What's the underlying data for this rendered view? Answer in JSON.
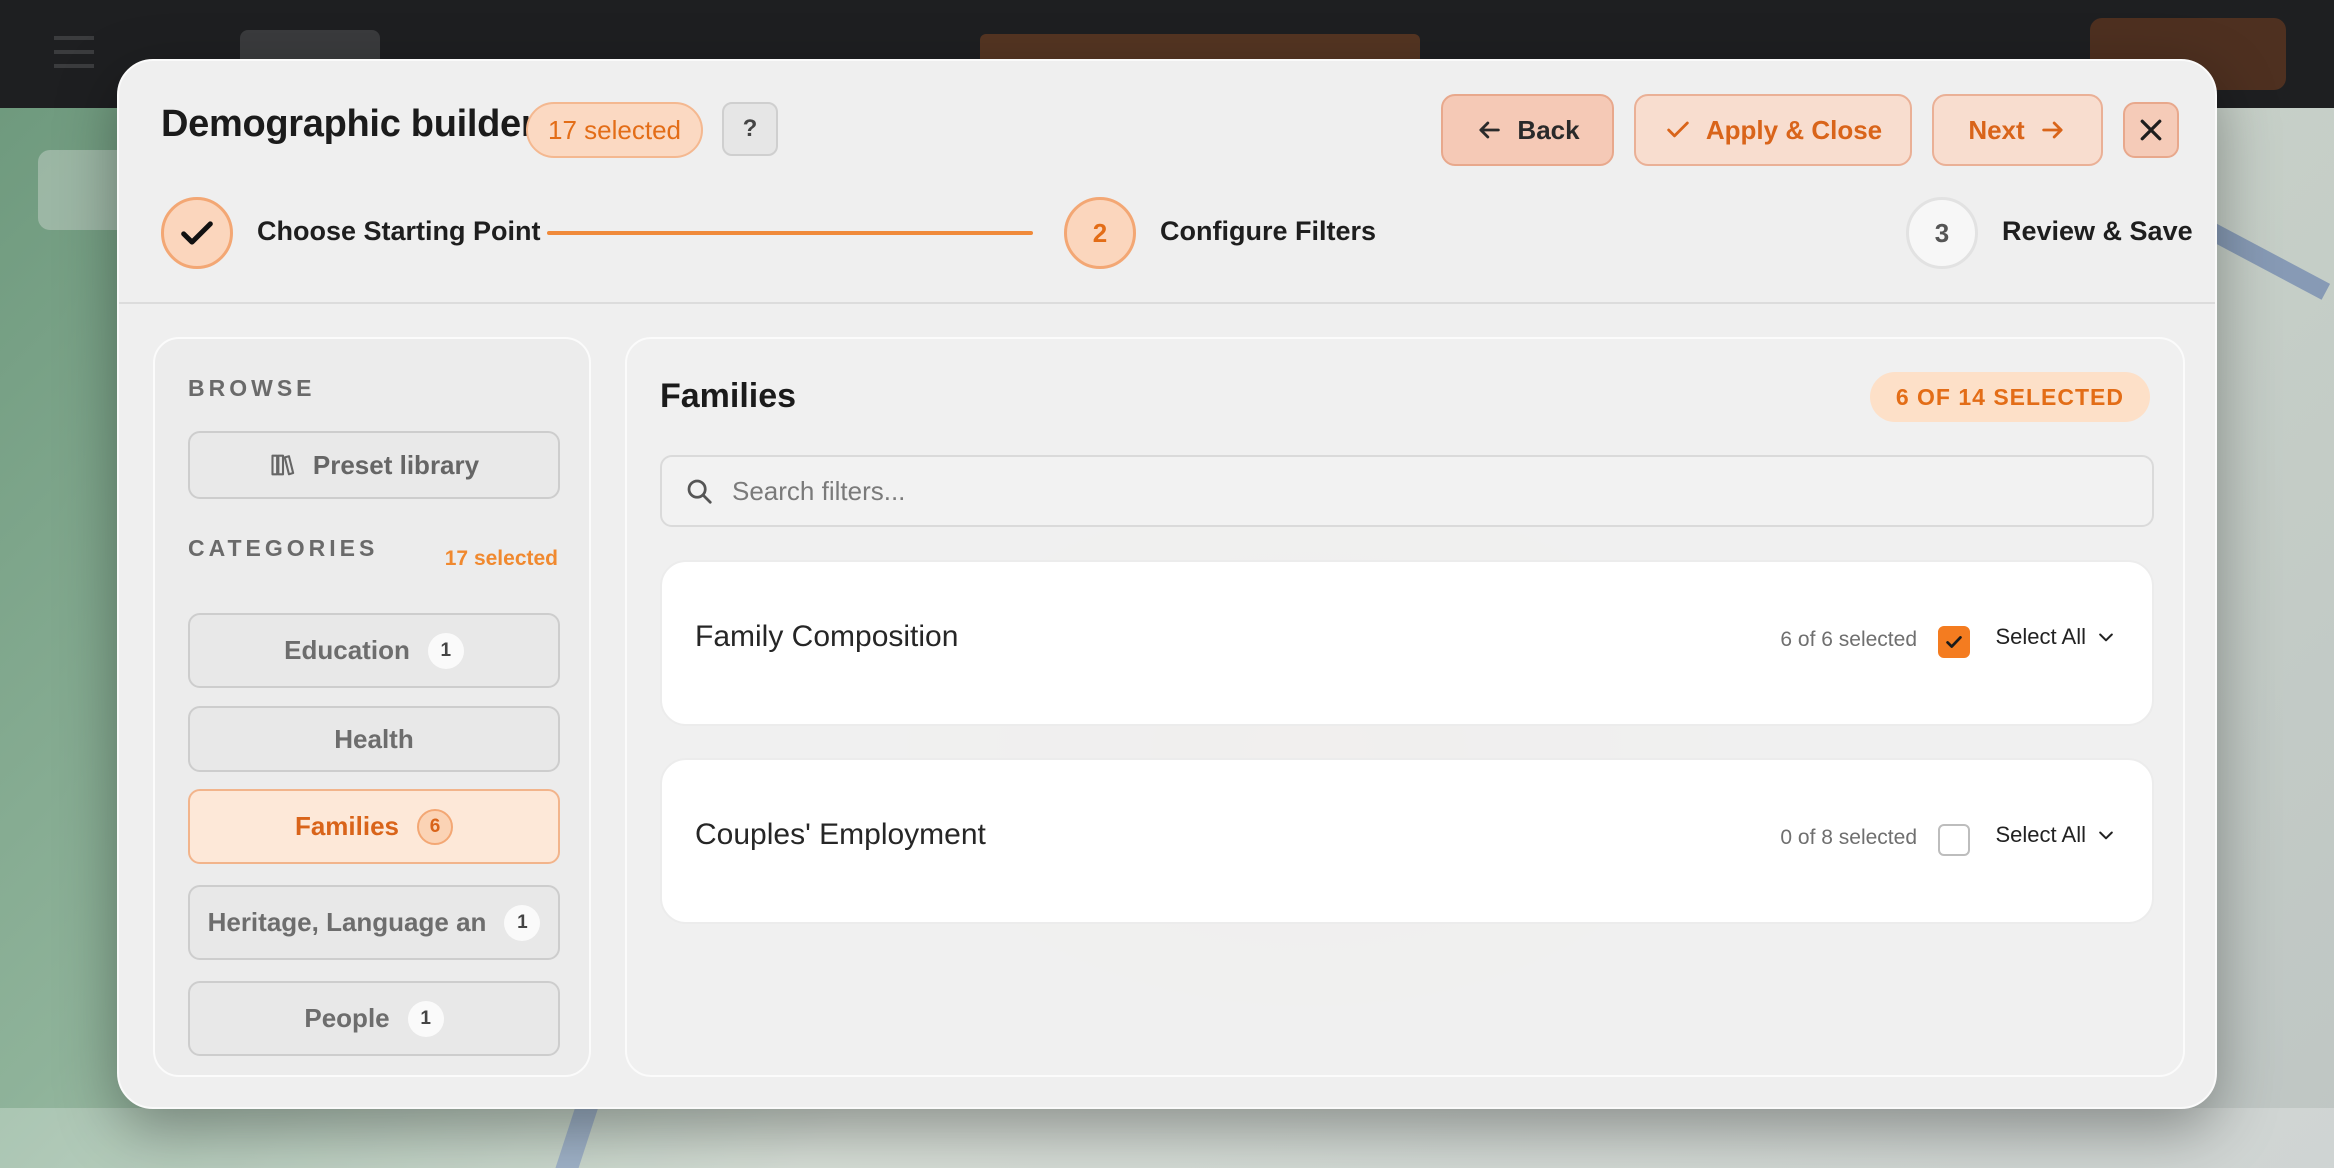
{
  "dialog": {
    "title": "Demographic builder",
    "selected_badge": "17 selected",
    "help_label": "?",
    "buttons": {
      "back": "Back",
      "apply_close": "Apply & Close",
      "next": "Next"
    }
  },
  "stepper": {
    "steps": [
      {
        "number": "",
        "label": "Choose Starting Point",
        "state": "complete"
      },
      {
        "number": "2",
        "label": "Configure Filters",
        "state": "current"
      },
      {
        "number": "3",
        "label": "Review & Save",
        "state": "upcoming"
      }
    ]
  },
  "sidebar": {
    "browse_label": "BROWSE",
    "preset_label": "Preset library",
    "categories_label": "CATEGORIES",
    "categories_count": "17 selected",
    "categories": [
      {
        "label": "Education",
        "count": "1",
        "active": false
      },
      {
        "label": "Health",
        "count": "",
        "active": false
      },
      {
        "label": "Families",
        "count": "6",
        "active": true
      },
      {
        "label": "Heritage, Language an",
        "count": "1",
        "active": false
      },
      {
        "label": "People",
        "count": "1",
        "active": false
      }
    ]
  },
  "main": {
    "title": "Families",
    "selected_badge": "6 OF 14 SELECTED",
    "search_placeholder": "Search filters...",
    "groups": [
      {
        "title": "Family Composition",
        "count": "6 of 6 selected",
        "checked": true,
        "select_all": "Select All"
      },
      {
        "title": "Couples' Employment",
        "count": "0 of 8 selected",
        "checked": false,
        "select_all": "Select All"
      }
    ]
  },
  "colors": {
    "accent": "#f47c20",
    "accent_soft": "#fde0c8",
    "dialog_bg": "#efefef"
  }
}
